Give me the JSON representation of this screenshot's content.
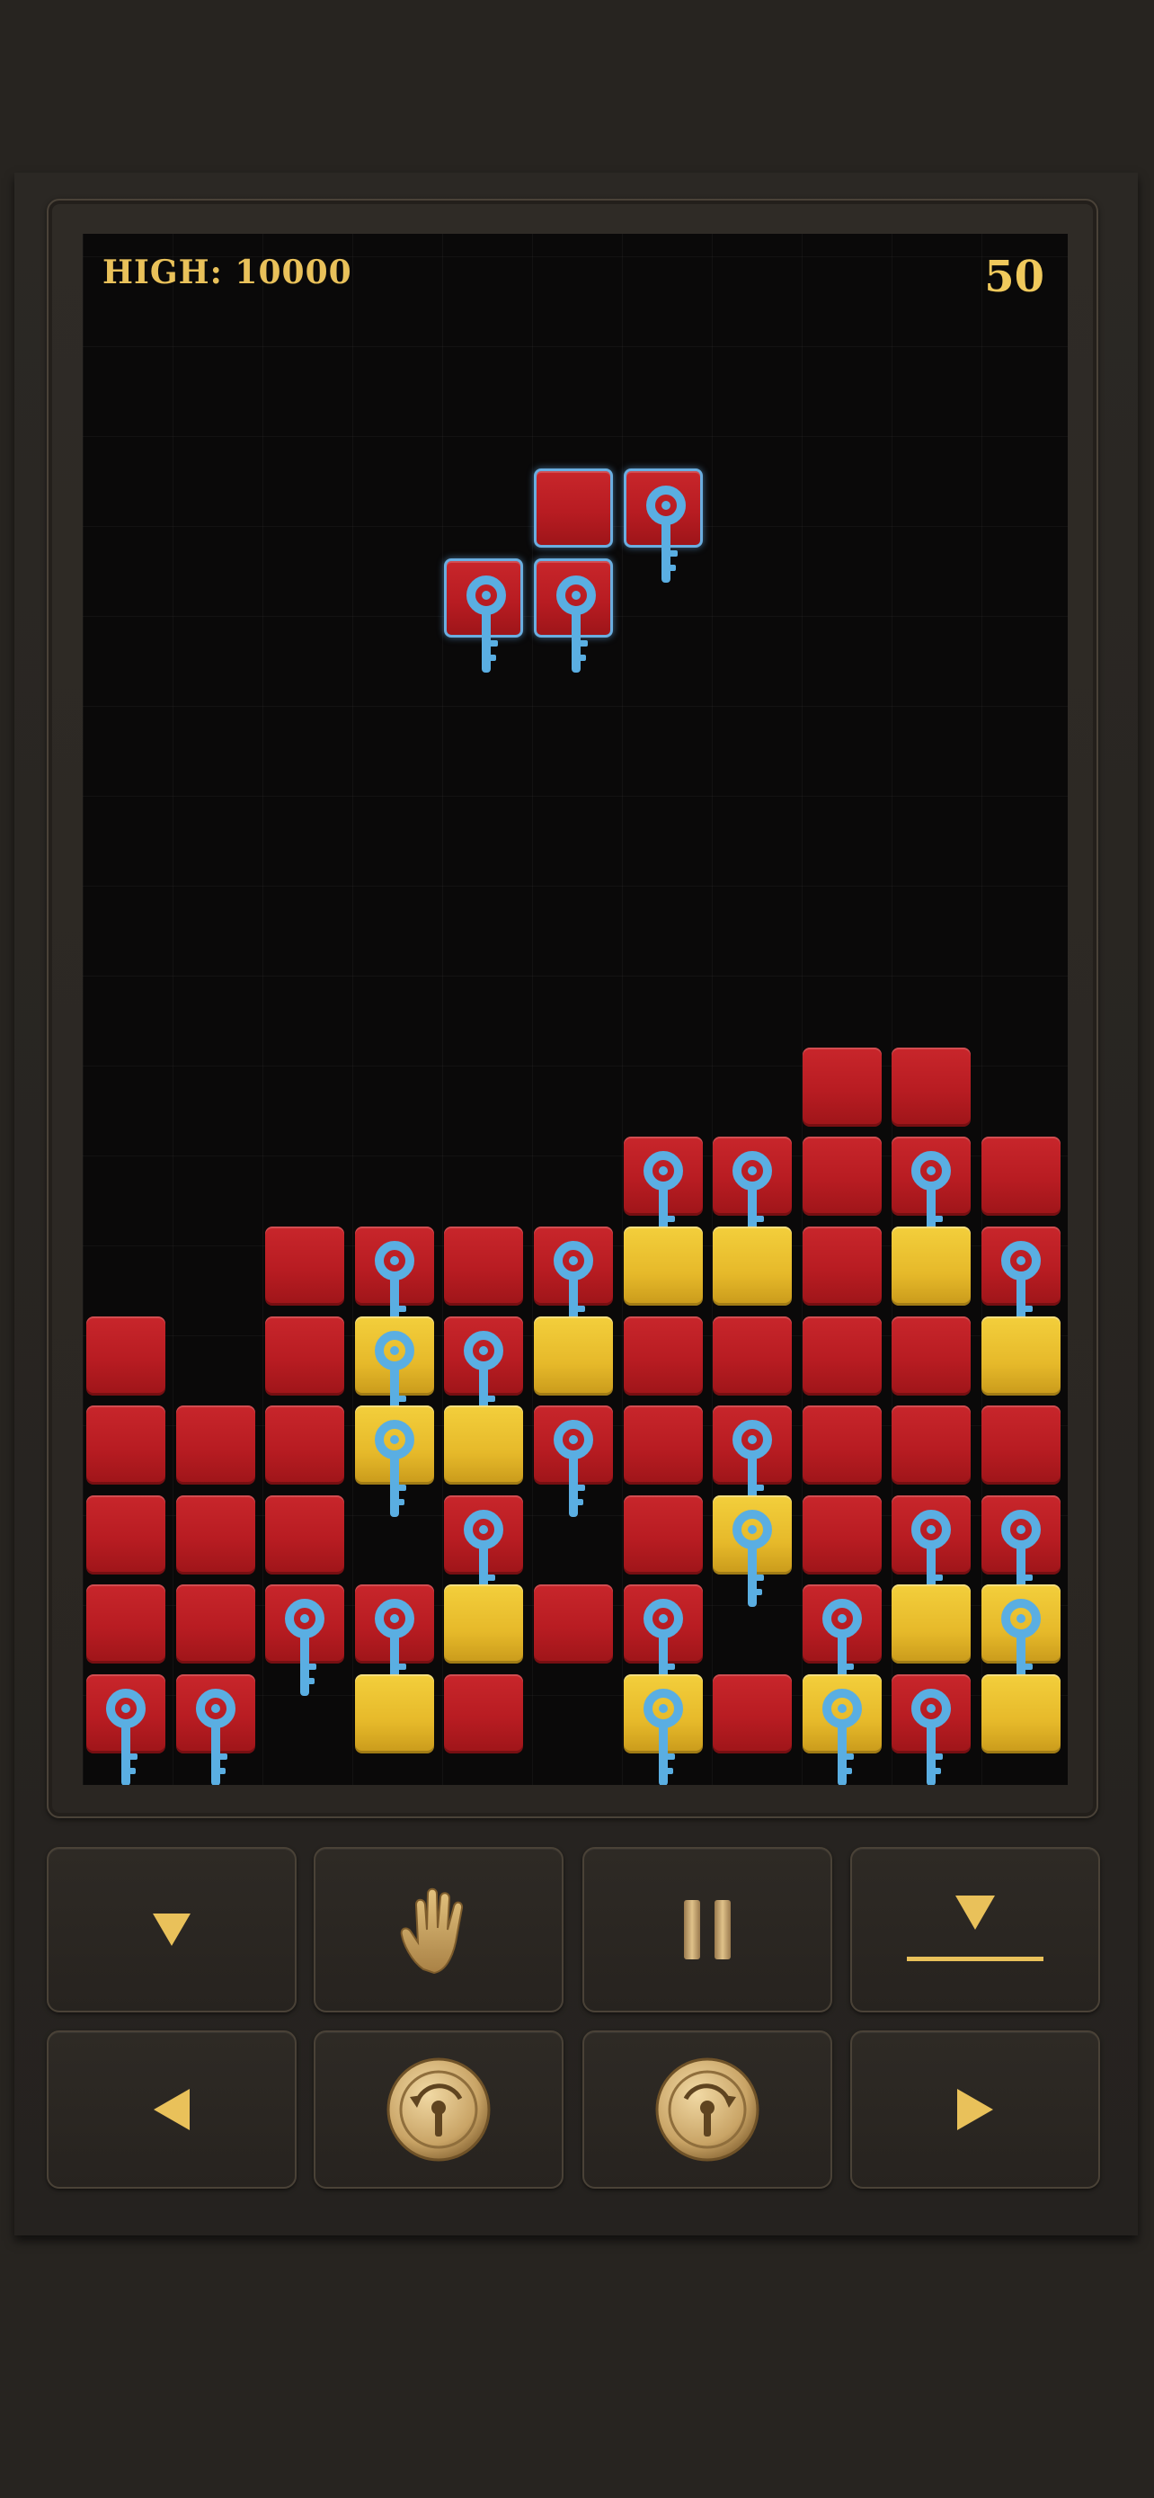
{
  "hud": {
    "high_label": "HIGH: 10000",
    "score": "50"
  },
  "colors": {
    "red": "#c01f25",
    "yellow": "#ecc232",
    "key": "#5aaee2",
    "gold": "#e9c15a"
  },
  "board": {
    "columns": 11,
    "active_piece": [
      {
        "col": 5,
        "row": 0,
        "color": "red",
        "key": false
      },
      {
        "col": 6,
        "row": 0,
        "color": "red",
        "key": true
      },
      {
        "col": 4,
        "row": 1,
        "color": "red",
        "key": true
      },
      {
        "col": 5,
        "row": 1,
        "color": "red",
        "key": true
      }
    ],
    "stack": [
      {
        "col": 8,
        "row": 6,
        "color": "red",
        "key": false
      },
      {
        "col": 9,
        "row": 6,
        "color": "red",
        "key": false
      },
      {
        "col": 6,
        "row": 7,
        "color": "red",
        "key": true
      },
      {
        "col": 7,
        "row": 7,
        "color": "red",
        "key": true
      },
      {
        "col": 8,
        "row": 7,
        "color": "red",
        "key": false
      },
      {
        "col": 9,
        "row": 7,
        "color": "red",
        "key": true
      },
      {
        "col": 10,
        "row": 7,
        "color": "red",
        "key": false
      },
      {
        "col": 2,
        "row": 8,
        "color": "red",
        "key": false
      },
      {
        "col": 3,
        "row": 8,
        "color": "red",
        "key": true
      },
      {
        "col": 4,
        "row": 8,
        "color": "red",
        "key": false
      },
      {
        "col": 5,
        "row": 8,
        "color": "red",
        "key": true
      },
      {
        "col": 6,
        "row": 8,
        "color": "yellow",
        "key": false
      },
      {
        "col": 7,
        "row": 8,
        "color": "yellow",
        "key": false
      },
      {
        "col": 8,
        "row": 8,
        "color": "red",
        "key": false
      },
      {
        "col": 9,
        "row": 8,
        "color": "yellow",
        "key": false
      },
      {
        "col": 10,
        "row": 8,
        "color": "red",
        "key": true
      },
      {
        "col": 0,
        "row": 9,
        "color": "red",
        "key": false
      },
      {
        "col": 2,
        "row": 9,
        "color": "red",
        "key": false
      },
      {
        "col": 3,
        "row": 9,
        "color": "yellow",
        "key": true
      },
      {
        "col": 4,
        "row": 9,
        "color": "red",
        "key": true
      },
      {
        "col": 5,
        "row": 9,
        "color": "yellow",
        "key": false
      },
      {
        "col": 6,
        "row": 9,
        "color": "red",
        "key": false
      },
      {
        "col": 7,
        "row": 9,
        "color": "red",
        "key": false
      },
      {
        "col": 8,
        "row": 9,
        "color": "red",
        "key": false
      },
      {
        "col": 9,
        "row": 9,
        "color": "red",
        "key": false
      },
      {
        "col": 10,
        "row": 9,
        "color": "yellow",
        "key": false
      },
      {
        "col": 0,
        "row": 10,
        "color": "red",
        "key": false
      },
      {
        "col": 1,
        "row": 10,
        "color": "red",
        "key": false
      },
      {
        "col": 2,
        "row": 10,
        "color": "red",
        "key": false
      },
      {
        "col": 3,
        "row": 10,
        "color": "yellow",
        "key": true
      },
      {
        "col": 4,
        "row": 10,
        "color": "yellow",
        "key": false
      },
      {
        "col": 5,
        "row": 10,
        "color": "red",
        "key": true
      },
      {
        "col": 6,
        "row": 10,
        "color": "red",
        "key": false
      },
      {
        "col": 7,
        "row": 10,
        "color": "red",
        "key": true
      },
      {
        "col": 8,
        "row": 10,
        "color": "red",
        "key": false
      },
      {
        "col": 9,
        "row": 10,
        "color": "red",
        "key": false
      },
      {
        "col": 10,
        "row": 10,
        "color": "red",
        "key": false
      },
      {
        "col": 0,
        "row": 11,
        "color": "red",
        "key": false
      },
      {
        "col": 1,
        "row": 11,
        "color": "red",
        "key": false
      },
      {
        "col": 2,
        "row": 11,
        "color": "red",
        "key": false
      },
      {
        "col": 4,
        "row": 11,
        "color": "red",
        "key": true
      },
      {
        "col": 6,
        "row": 11,
        "color": "red",
        "key": false
      },
      {
        "col": 7,
        "row": 11,
        "color": "yellow",
        "key": true
      },
      {
        "col": 8,
        "row": 11,
        "color": "red",
        "key": false
      },
      {
        "col": 9,
        "row": 11,
        "color": "red",
        "key": true
      },
      {
        "col": 10,
        "row": 11,
        "color": "red",
        "key": true
      },
      {
        "col": 0,
        "row": 12,
        "color": "red",
        "key": false
      },
      {
        "col": 1,
        "row": 12,
        "color": "red",
        "key": false
      },
      {
        "col": 2,
        "row": 12,
        "color": "red",
        "key": true
      },
      {
        "col": 3,
        "row": 12,
        "color": "red",
        "key": true
      },
      {
        "col": 4,
        "row": 12,
        "color": "yellow",
        "key": false
      },
      {
        "col": 5,
        "row": 12,
        "color": "red",
        "key": false
      },
      {
        "col": 6,
        "row": 12,
        "color": "red",
        "key": true
      },
      {
        "col": 8,
        "row": 12,
        "color": "red",
        "key": true
      },
      {
        "col": 9,
        "row": 12,
        "color": "yellow",
        "key": false
      },
      {
        "col": 10,
        "row": 12,
        "color": "yellow",
        "key": true
      },
      {
        "col": 0,
        "row": 13,
        "color": "red",
        "key": true
      },
      {
        "col": 1,
        "row": 13,
        "color": "red",
        "key": true
      },
      {
        "col": 3,
        "row": 13,
        "color": "yellow",
        "key": false
      },
      {
        "col": 4,
        "row": 13,
        "color": "red",
        "key": false
      },
      {
        "col": 6,
        "row": 13,
        "color": "yellow",
        "key": true
      },
      {
        "col": 7,
        "row": 13,
        "color": "red",
        "key": false
      },
      {
        "col": 8,
        "row": 13,
        "color": "yellow",
        "key": true
      },
      {
        "col": 9,
        "row": 13,
        "color": "red",
        "key": true
      },
      {
        "col": 10,
        "row": 13,
        "color": "yellow",
        "key": false
      }
    ]
  },
  "controls": {
    "row1": [
      {
        "name": "soft-drop-button",
        "icon": "triangle-down-icon"
      },
      {
        "name": "hold-button",
        "icon": "hand-icon"
      },
      {
        "name": "pause-button",
        "icon": "pause-icon"
      },
      {
        "name": "hard-drop-button",
        "icon": "drop-to-bottom-icon"
      }
    ],
    "row2": [
      {
        "name": "move-left-button",
        "icon": "triangle-left-icon"
      },
      {
        "name": "rotate-ccw-button",
        "icon": "rotate-ccw-dial-icon"
      },
      {
        "name": "rotate-cw-button",
        "icon": "rotate-cw-dial-icon"
      },
      {
        "name": "move-right-button",
        "icon": "triangle-right-icon"
      }
    ]
  }
}
